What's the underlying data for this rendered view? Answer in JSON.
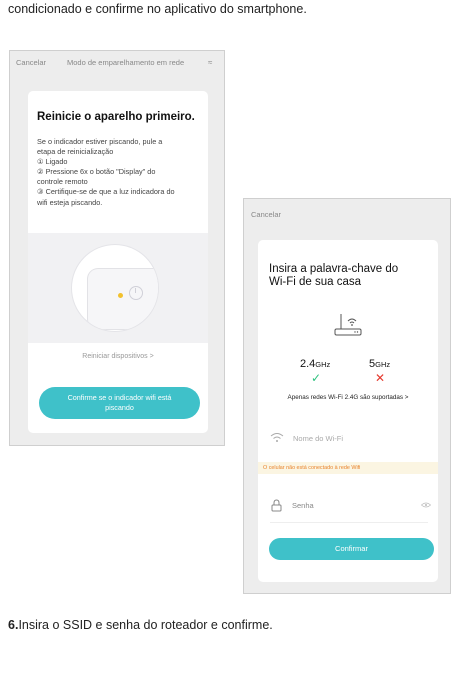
{
  "document": {
    "top_caption": "condicionado e confirme no aplicativo do smartphone.",
    "step_number": "6.",
    "step_text": "Insira o SSID e senha do roteador e confirme."
  },
  "screen1": {
    "cancel": "Cancelar",
    "mode": "Modo de emparelhamento em rede",
    "mode_icon": "≈",
    "title": "Reinicie o aparelho primeiro.",
    "lines": [
      "Se o indicador estiver piscando, pule a",
      "etapa de reinicialização",
      "① Ligado",
      "② Pressione 6x o botão \"Display\" do",
      "controle remoto",
      "③ Certifique-se de que a luz indicadora do",
      "wifi esteja piscando."
    ],
    "restart_link": "Reiniciar dispositivos  >",
    "confirm_line1": "Confirme se o indicador wifi está",
    "confirm_line2": "piscando",
    "led_color": "#f2c12e",
    "accent": "#3fc1c9"
  },
  "screen2": {
    "cancel": "Cancelar",
    "title_line1": "Insira a palavra-chave do",
    "title_line2": "Wi-Fi de sua casa",
    "band1_num": "2.4",
    "band1_unit": "GHz",
    "band2_num": "5",
    "band2_unit": "GHz",
    "check": "✓",
    "cross": "✕",
    "support_note": "Apenas redes Wi-Fi 2.4G são suportadas >",
    "wifi_placeholder": "Nome do Wi-Fi",
    "warning": "O celular não está conectado à rede Wifi",
    "password_placeholder": "Senha",
    "confirm": "Confirmar",
    "ok_color": "#2ec27e",
    "error_color": "#e5392e",
    "warning_color": "#e8832c"
  }
}
